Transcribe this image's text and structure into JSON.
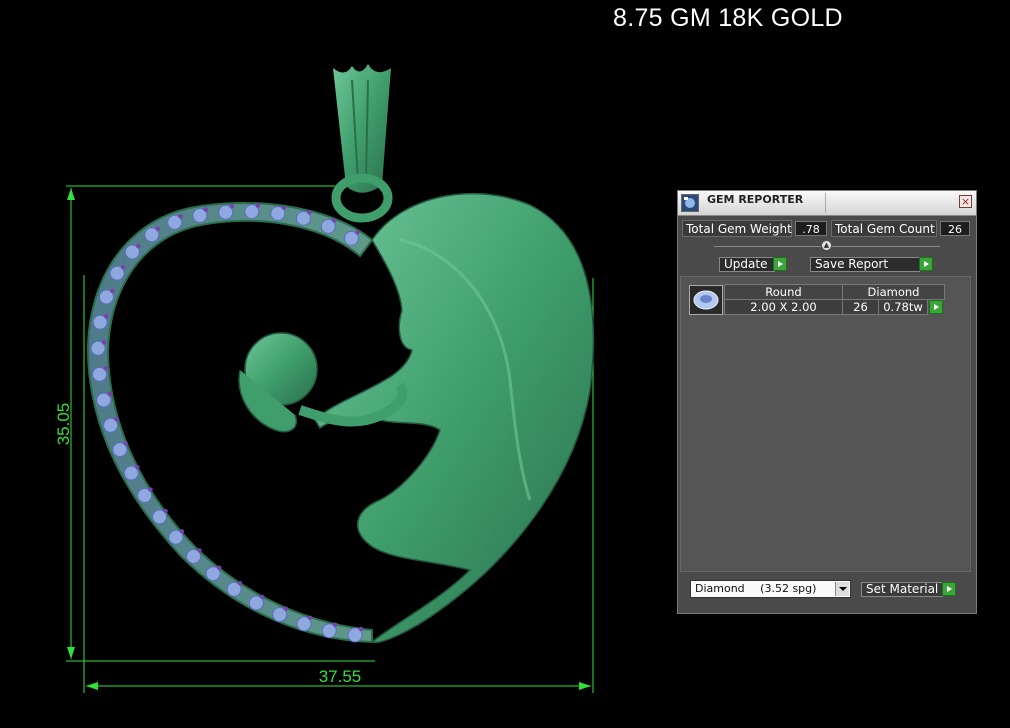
{
  "header": {
    "title": "8.75 GM 18K GOLD"
  },
  "dimensions": {
    "height_label": "35.05",
    "width_label": "37.55"
  },
  "colors": {
    "dimension_line": "#33e03a",
    "metal": "#3f9e6c",
    "gem_stone": "#8fa8e0",
    "gem_prong": "#7a3fb0"
  },
  "gem_reporter": {
    "title": "GEM REPORTER",
    "total_gem_weight_label": "Total Gem Weight",
    "total_gem_weight_value": ".78",
    "total_gem_count_label": "Total Gem Count",
    "total_gem_count_value": "26",
    "update_label": "Update",
    "save_report_label": "Save Report",
    "close_label": "×",
    "table": {
      "headers": [
        "Round",
        "Diamond"
      ],
      "rows": [
        {
          "size": "2.00 X 2.00",
          "count": "26",
          "weight": "0.78tw"
        }
      ]
    },
    "material_select": {
      "value": "Diamond",
      "spg": "(3.52 spg)"
    },
    "set_material_label": "Set Material"
  }
}
